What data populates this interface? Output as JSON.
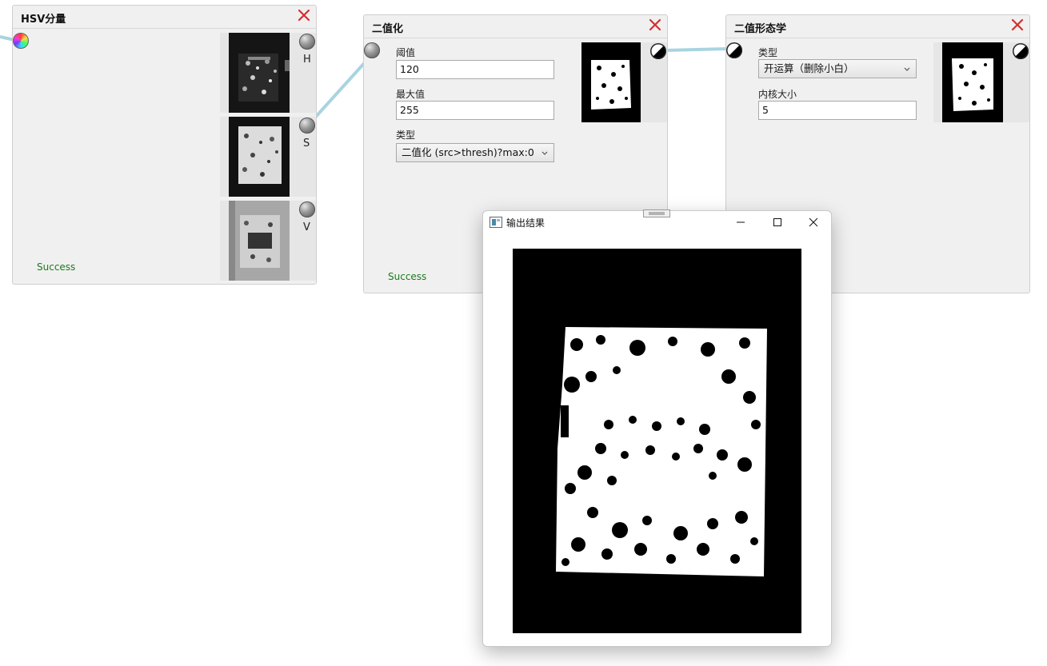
{
  "hsv_node": {
    "title": "HSV分量",
    "channels": [
      {
        "label": "H",
        "icon": "gray-port-icon"
      },
      {
        "label": "S",
        "icon": "gray-port-icon"
      },
      {
        "label": "V",
        "icon": "gray-port-icon"
      }
    ],
    "input_icon": "rainbow-port-icon",
    "status": "Success"
  },
  "binarize_node": {
    "title": "二值化",
    "threshold_label": "阈值",
    "threshold_value": "120",
    "max_label": "最大值",
    "max_value": "255",
    "type_label": "类型",
    "type_value": "二值化 (src>thresh)?max:0",
    "status": "Success"
  },
  "morph_node": {
    "title": "二值形态学",
    "type_label": "类型",
    "type_value": "开运算（删除小白）",
    "kernel_label": "内核大小",
    "kernel_value": "5"
  },
  "output_window": {
    "title": "输出结果",
    "minimize_icon": "minimize-icon",
    "maximize_icon": "maximize-icon",
    "close_icon": "close-icon"
  },
  "colors": {
    "node_bg": "#f0f0f0",
    "link": "#a8d4e0",
    "close_red": "#d32f2f",
    "success_green": "#1a7a1a"
  }
}
